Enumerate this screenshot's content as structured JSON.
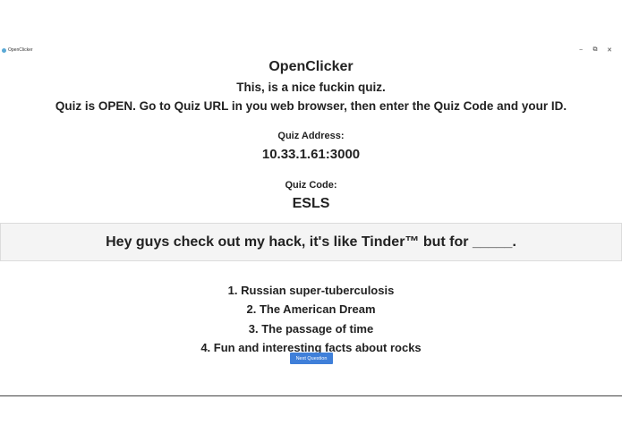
{
  "window": {
    "title": "OpenClicker",
    "logo_color": "#5aa9d6",
    "controls": {
      "minimize_icon": "minimize-icon",
      "restore_icon": "restore-icon",
      "close_icon": "close-icon",
      "minimize_glyph": "−",
      "restore_glyph": "⧉",
      "close_glyph": "✕"
    }
  },
  "main": {
    "app_title": "OpenClicker",
    "quiz_name": "This, is a nice fuckin quiz.",
    "status_instructions": "Quiz is OPEN. Go to Quiz URL in you web browser, then enter the Quiz Code and your ID.",
    "address_label": "Quiz Address:",
    "address_value": "10.33.1.61:3000",
    "code_label": "Quiz Code:",
    "code_value": "ESLS"
  },
  "question": {
    "text": "Hey guys check out my hack, it's like Tinder™ but for _____.",
    "band_color": "#f4f4f4"
  },
  "answers": [
    "1. Russian super-tuberculosis",
    "2. The American Dream",
    "3. The passage of time",
    "4. Fun and interesting facts about rocks"
  ],
  "next_button": {
    "label": "Next Question",
    "color": "#3f7fd9"
  }
}
